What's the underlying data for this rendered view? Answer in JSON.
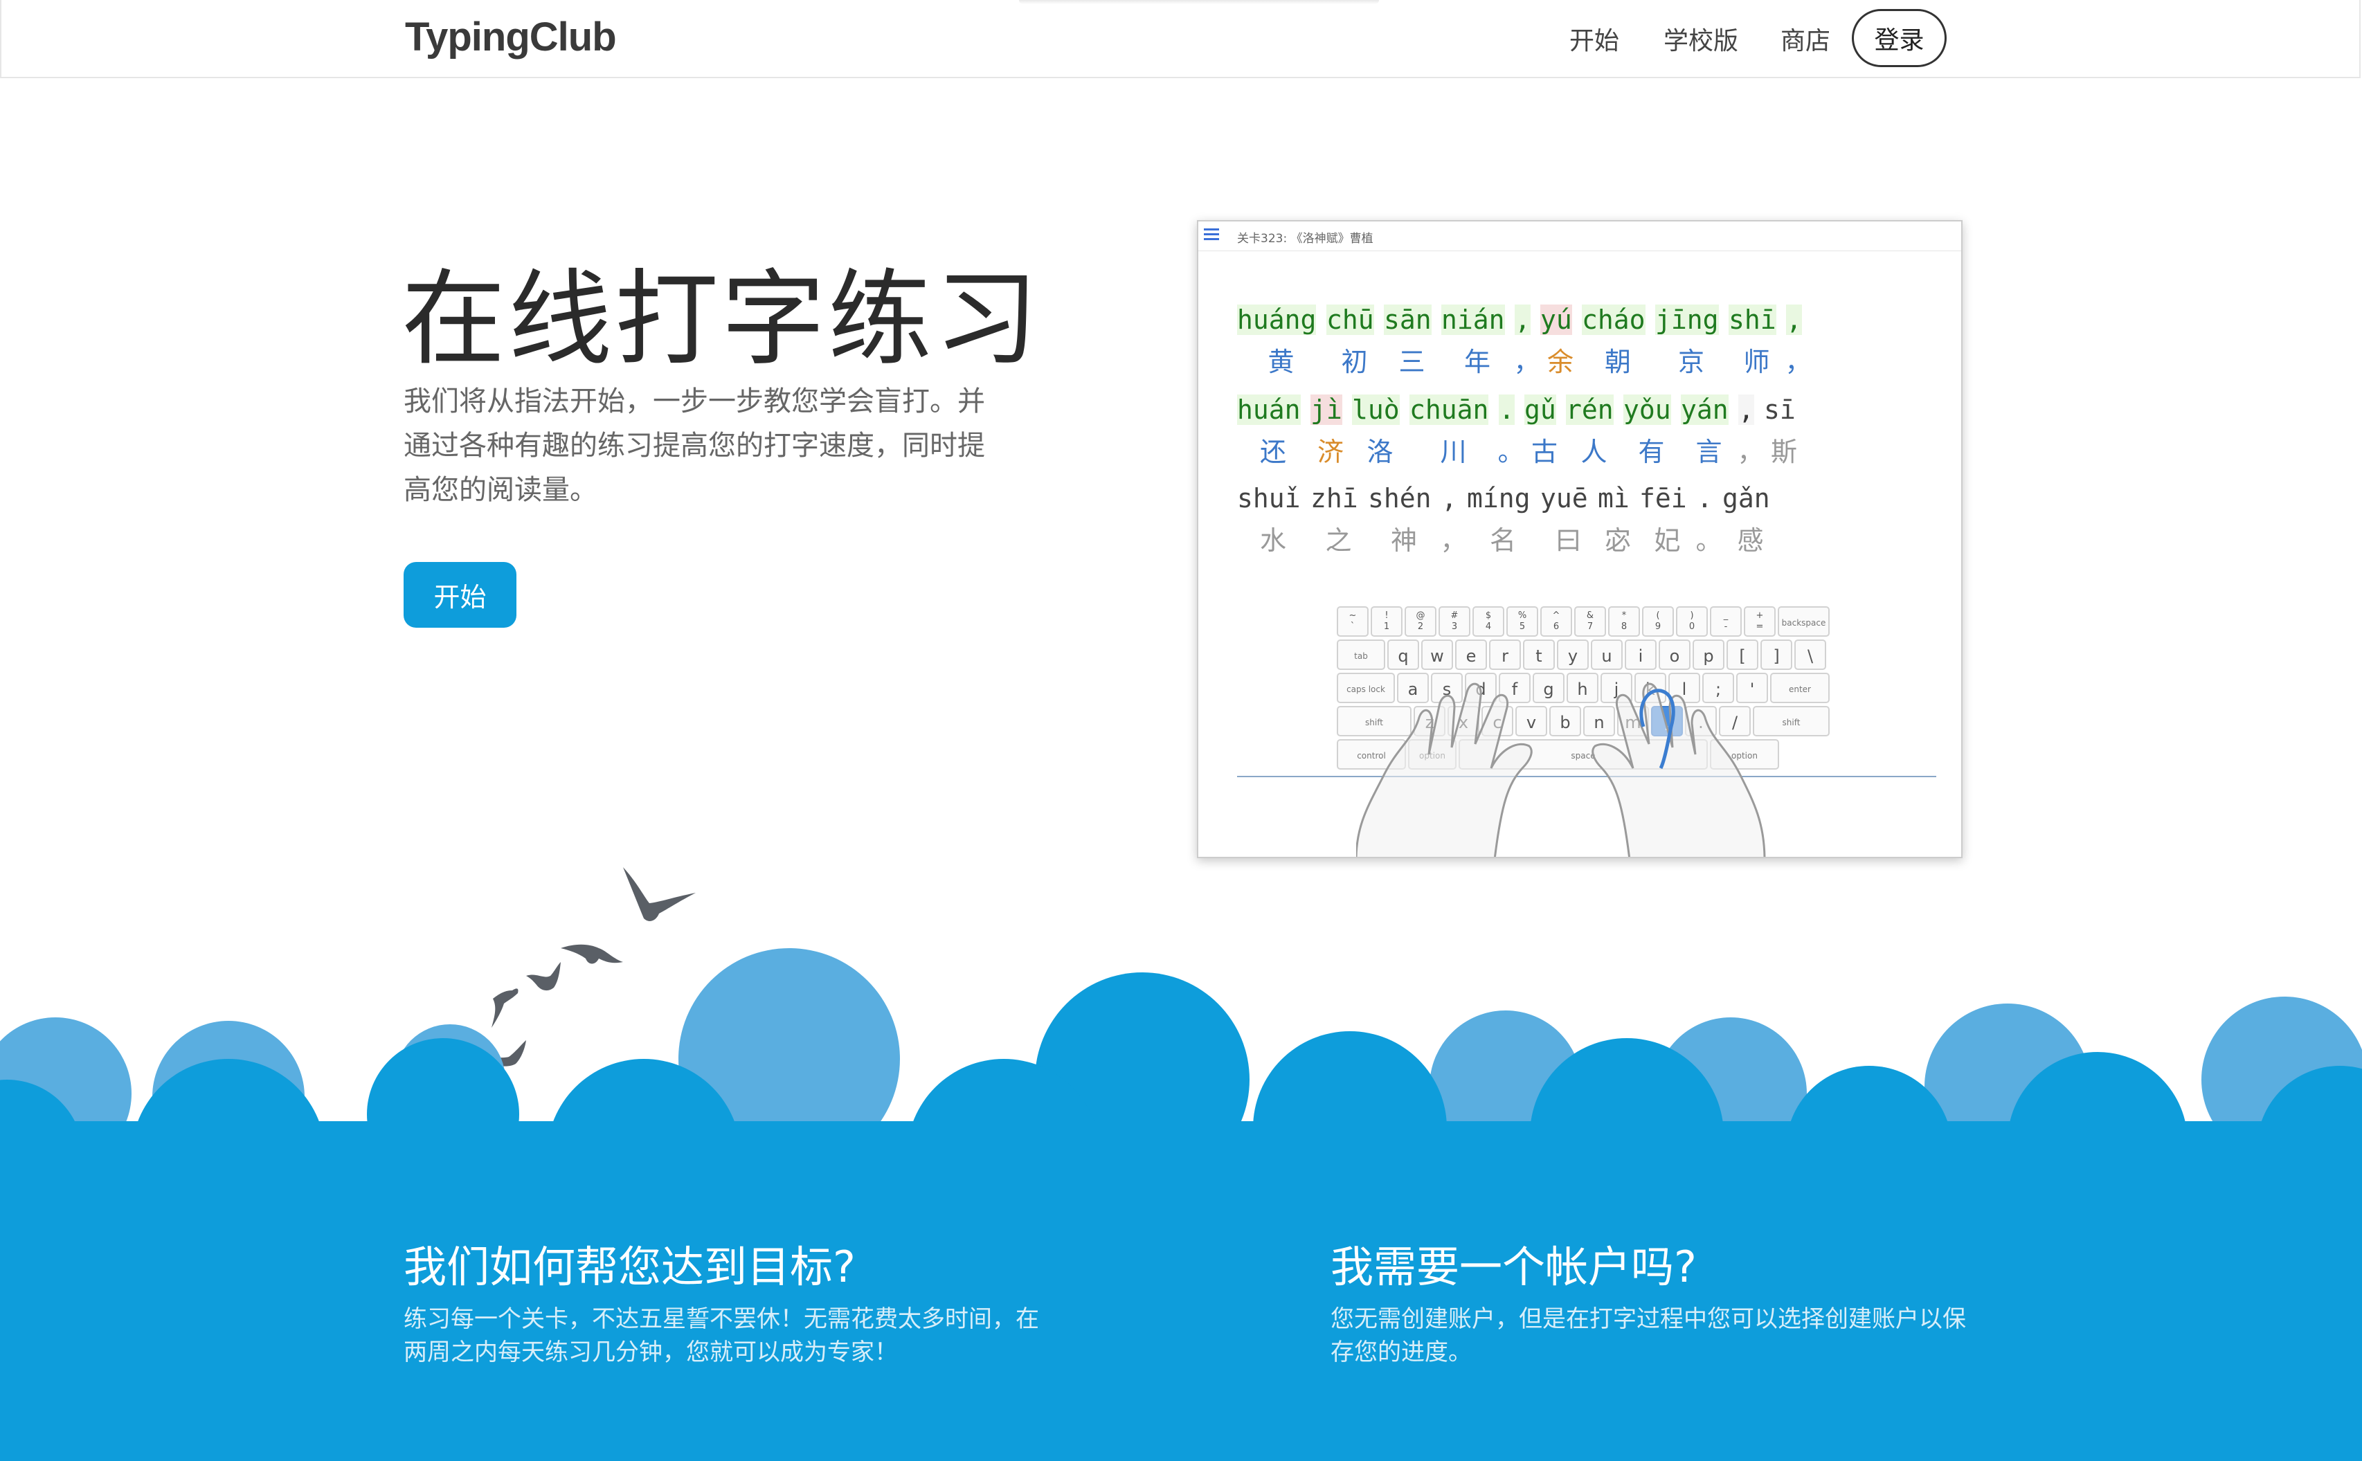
{
  "header": {
    "logo": "TypingClub",
    "nav": [
      "开始",
      "学校版",
      "商店"
    ],
    "login": "登录"
  },
  "hero": {
    "title": "在线打字练习",
    "description": "我们将从指法开始，一步一步教您学会盲打。并通过各种有趣的练习提高您的打字速度，同时提高您的阅读量。",
    "start_button": "开始"
  },
  "preview": {
    "level_title": "关卡323: 《洛神赋》曹植",
    "line1_pinyin": [
      "huáng",
      "chū",
      "sān",
      "nián",
      ",",
      "yú",
      "cháo",
      "jīng",
      "shī",
      ","
    ],
    "line1_hanzi": [
      "黄",
      "初",
      "三",
      "年",
      "，",
      "余",
      "朝",
      "京",
      "师",
      "，"
    ],
    "line2_pinyin": [
      "huán",
      "jì",
      "luò",
      "chuān",
      ".",
      "gǔ",
      "rén",
      "yǒu",
      "yán",
      ",",
      "sī"
    ],
    "line2_hanzi": [
      "还",
      "济",
      "洛",
      "川",
      "。",
      "古",
      "人",
      "有",
      "言",
      "，",
      "斯"
    ],
    "line3_pinyin": [
      "shuǐ",
      "zhī",
      "shén",
      ",",
      "míng",
      "yuē",
      "mì",
      "fēi",
      ".",
      "gǎn"
    ],
    "line3_hanzi": [
      "水",
      "之",
      "神",
      "，",
      "名",
      "曰",
      "宓",
      "妃",
      "。",
      "感"
    ],
    "keyboard": {
      "row1": [
        [
          "~",
          "`"
        ],
        [
          "!",
          "1"
        ],
        [
          "@",
          "2"
        ],
        [
          "#",
          "3"
        ],
        [
          "$",
          "4"
        ],
        [
          "%",
          "5"
        ],
        [
          "^",
          "6"
        ],
        [
          "&",
          "7"
        ],
        [
          "*",
          "8"
        ],
        [
          "(",
          "9"
        ],
        [
          ")",
          "0"
        ],
        [
          "_",
          "-"
        ],
        [
          "+",
          "="
        ]
      ],
      "backspace": "backspace",
      "tab": "tab",
      "row2": [
        "q",
        "w",
        "e",
        "r",
        "t",
        "y",
        "u",
        "i",
        "o",
        "p",
        "[",
        "]",
        "\\"
      ],
      "caps": "caps lock",
      "row3": [
        "a",
        "s",
        "d",
        "f",
        "g",
        "h",
        "j",
        "k",
        "l",
        ";",
        "'"
      ],
      "enter": "enter",
      "shift": "shift",
      "row4": [
        "z",
        "x",
        "c",
        "v",
        "b",
        "n",
        "m",
        ",",
        ".",
        "/"
      ],
      "control": "control",
      "option": "option",
      "space": "space"
    }
  },
  "features": {
    "left_title": "我们如何帮您达到目标?",
    "left_text": "练习每一个关卡，不达五星誓不罢休！无需花费太多时间，在两周之内每天练习几分钟，您就可以成为专家！",
    "right_title": "我需要一个帐户吗?",
    "right_text": "您无需创建账户，但是在打字过程中您可以选择创建账户以保存您的进度。"
  },
  "colors": {
    "brand_blue": "#0e9ddb",
    "cloud_light": "#5aaee0"
  }
}
